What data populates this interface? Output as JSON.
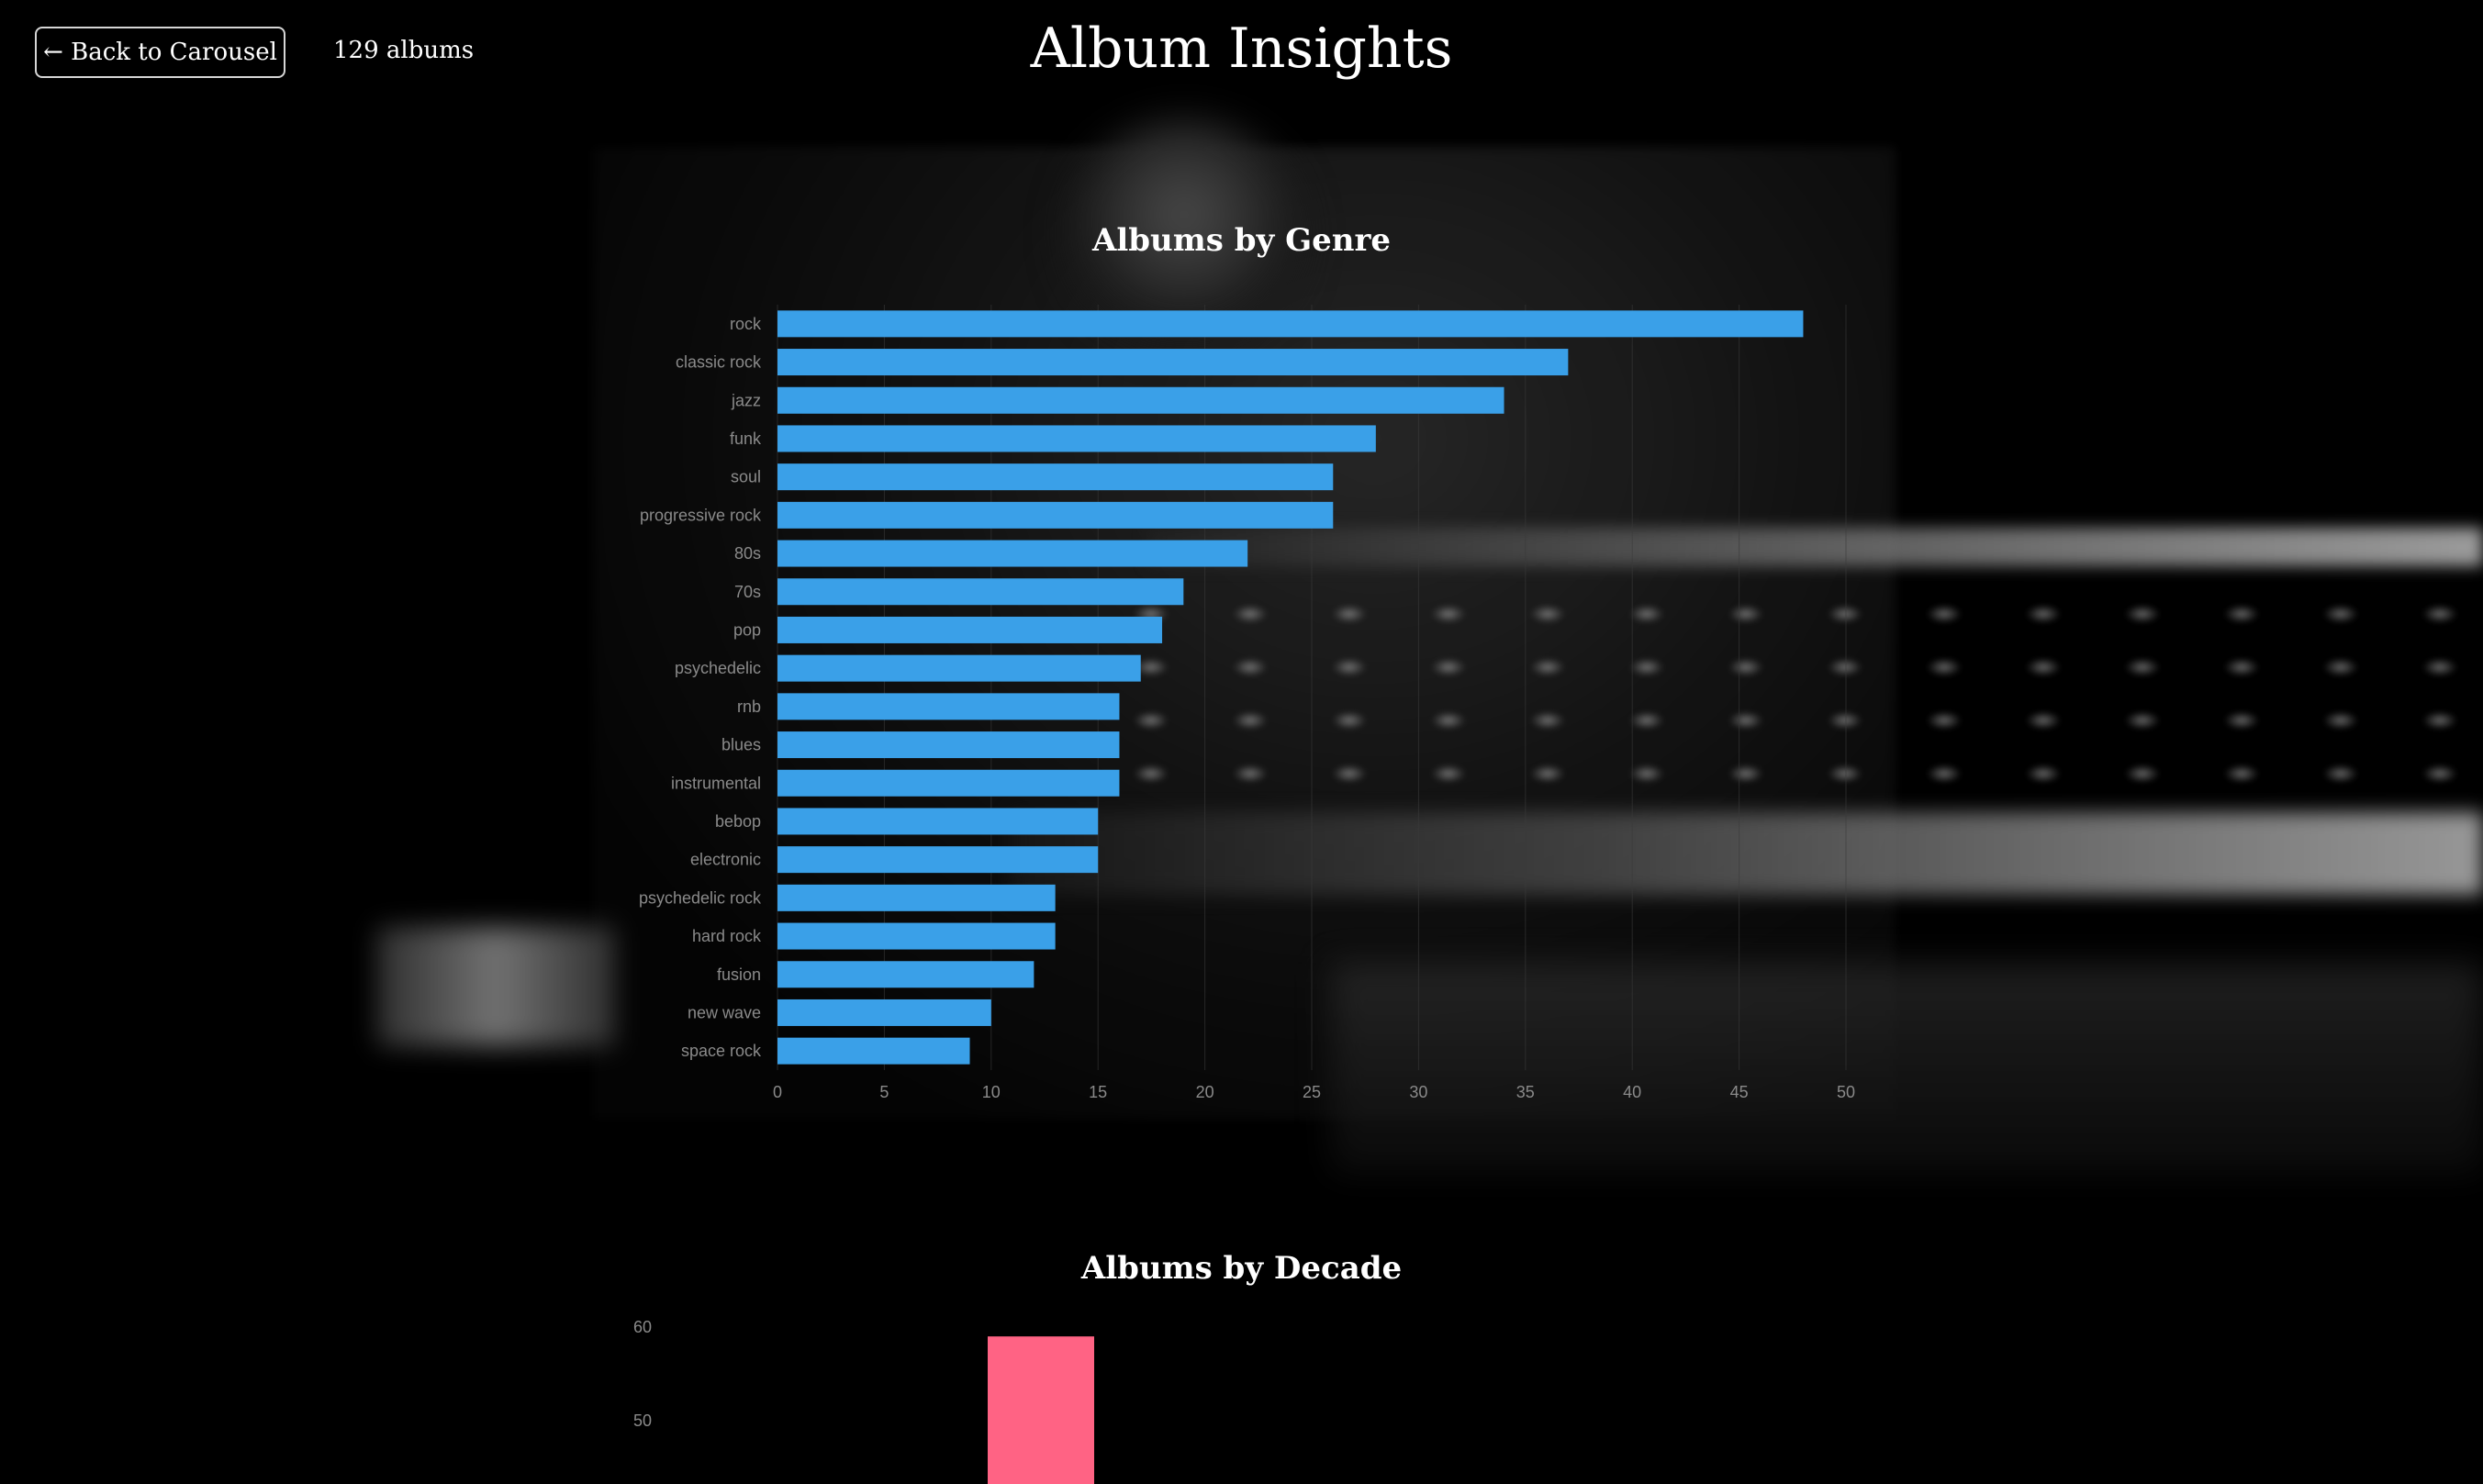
{
  "header": {
    "back_label": "← Back to Carousel",
    "album_count": "129 albums",
    "title": "Album Insights"
  },
  "colors": {
    "genre_bar": "#3aa0e8",
    "decade_bar": "#ff6384",
    "tick_text": "#8a8a8a",
    "grid": "#3a3a3a"
  },
  "chart_data": [
    {
      "type": "bar",
      "orientation": "horizontal",
      "title": "Albums by Genre",
      "categories": [
        "rock",
        "classic rock",
        "jazz",
        "funk",
        "soul",
        "progressive rock",
        "80s",
        "70s",
        "pop",
        "psychedelic",
        "rnb",
        "blues",
        "instrumental",
        "bebop",
        "electronic",
        "psychedelic rock",
        "hard rock",
        "fusion",
        "new wave",
        "space rock"
      ],
      "values": [
        48,
        37,
        34,
        28,
        26,
        26,
        22,
        19,
        18,
        17,
        16,
        16,
        16,
        15,
        15,
        13,
        13,
        12,
        10,
        9
      ],
      "xlim": [
        0,
        50
      ],
      "xticks": [
        0,
        5,
        10,
        15,
        20,
        25,
        30,
        35,
        40,
        45,
        50
      ],
      "grid": true,
      "legend": "none"
    },
    {
      "type": "bar",
      "orientation": "vertical",
      "title": "Albums by Decade",
      "categories": [
        ""
      ],
      "values": [
        59
      ],
      "ylim": [
        0,
        60
      ],
      "yticks": [
        60,
        50
      ],
      "note_visible": "chart is cut off at bottom of viewport; only the first bar and upper ticks are visible"
    }
  ]
}
